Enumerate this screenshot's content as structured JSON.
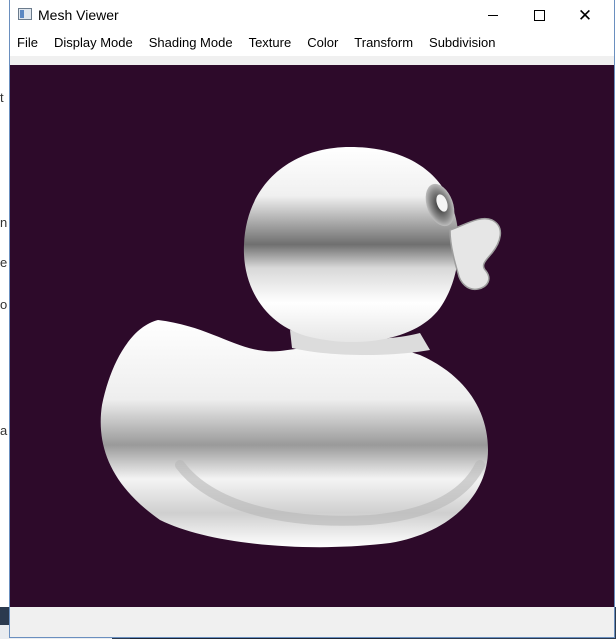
{
  "window": {
    "title": "Mesh Viewer",
    "controls": {
      "minimize": "minimize-icon",
      "maximize": "maximize-icon",
      "close": "close-icon"
    }
  },
  "menu": {
    "items": [
      {
        "label": "File"
      },
      {
        "label": "Display Mode"
      },
      {
        "label": "Shading Mode"
      },
      {
        "label": "Texture"
      },
      {
        "label": "Color"
      },
      {
        "label": "Transform"
      },
      {
        "label": "Subdivision"
      }
    ]
  },
  "viewport": {
    "background_color": "#2d0a2a",
    "model": "rubber-duck-mesh",
    "model_color": "#ffffff"
  },
  "colors": {
    "titlebar": "#ffffff",
    "window_border": "#6a8fbf"
  }
}
